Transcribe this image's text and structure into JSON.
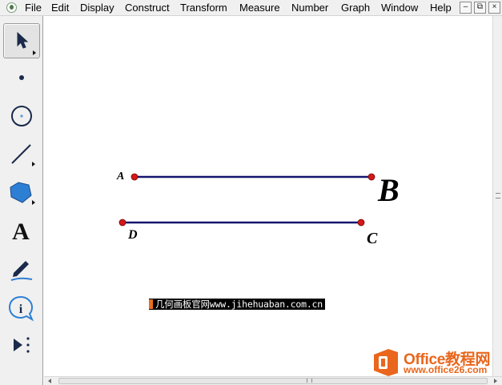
{
  "menu": {
    "items": [
      "File",
      "Edit",
      "Display",
      "Construct",
      "Transform",
      "Measure",
      "Number",
      "Graph",
      "Window",
      "Help"
    ]
  },
  "window_controls": {
    "minimize": "–",
    "restore": "⧉",
    "close": "×"
  },
  "toolbox": {
    "tools": [
      "arrow-select",
      "point",
      "compass",
      "straightedge",
      "polygon",
      "text",
      "marker",
      "information",
      "custom-tools"
    ],
    "selected": "arrow-select"
  },
  "canvas": {
    "points": {
      "A": "A",
      "B": "B",
      "C": "C",
      "D": "D"
    },
    "colors": {
      "segment": "#14146e",
      "point": "#d61818"
    },
    "caption": "几何画板官网www.jihehuaban.com.cn"
  },
  "watermark": {
    "brand": "Office教程网",
    "url": "www.office26.com",
    "color": "#e9661c"
  }
}
